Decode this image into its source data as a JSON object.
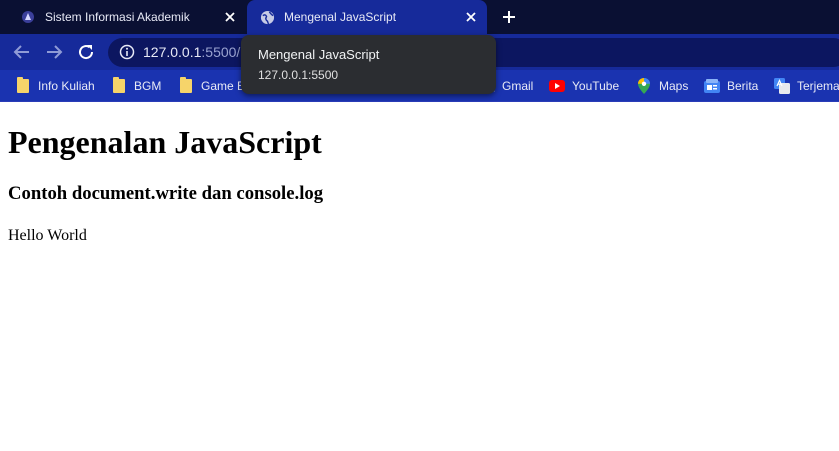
{
  "browser": {
    "tabs": [
      {
        "title": "Sistem Informasi Akademik",
        "favicon": "campus-logo-icon",
        "active": false
      },
      {
        "title": "Mengenal JavaScript",
        "favicon": "globe-icon",
        "active": true
      }
    ],
    "address_bar": {
      "url_host": "127.0.0.1",
      "url_rest": ":5500/"
    },
    "bookmarks": [
      {
        "label": "Info Kuliah",
        "icon": "folder-icon"
      },
      {
        "label": "BGM",
        "icon": "folder-icon"
      },
      {
        "label": "Game E",
        "icon": "folder-icon"
      },
      {
        "label": "Gmail",
        "icon": "gmail-icon"
      },
      {
        "label": "YouTube",
        "icon": "youtube-icon"
      },
      {
        "label": "Maps",
        "icon": "maps-icon"
      },
      {
        "label": "Berita",
        "icon": "news-icon"
      },
      {
        "label": "Terjema",
        "icon": "translate-icon"
      }
    ],
    "tooltip": {
      "title": "Mengenal JavaScript",
      "url": "127.0.0.1:5500"
    },
    "colors": {
      "tabstrip": "#0a1033",
      "toolbar": "#162a9a",
      "bookmarks_bar": "#1a33b0",
      "tooltip": "#2b2d31"
    }
  },
  "page": {
    "heading": "Pengenalan JavaScript",
    "subheading": "Contoh document.write dan console.log",
    "output_text": "Hello World"
  }
}
